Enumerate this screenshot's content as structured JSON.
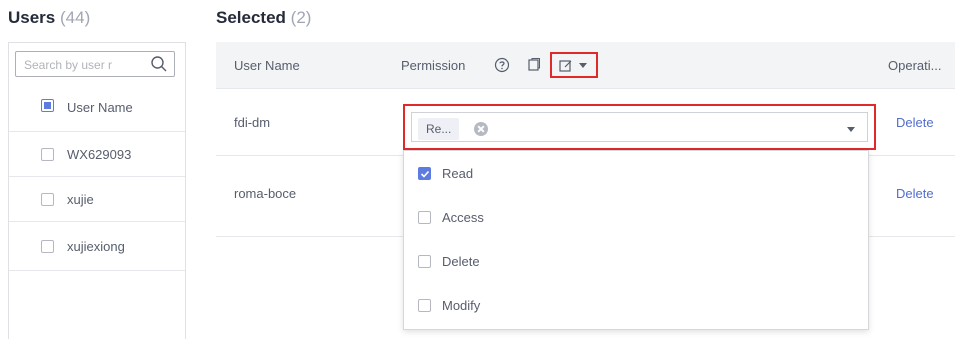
{
  "users_panel": {
    "title": "Users",
    "count": "(44)",
    "search_placeholder": "Search by user r",
    "header_label": "User Name",
    "items": [
      {
        "label": "WX629093"
      },
      {
        "label": "xujie"
      },
      {
        "label": "xujiexiong"
      }
    ]
  },
  "selected_panel": {
    "title": "Selected",
    "count": "(2)",
    "columns": {
      "user_name": "User Name",
      "permission": "Permission",
      "operation": "Operati..."
    },
    "rows": [
      {
        "user": "fdi-dm",
        "tag": "Re...",
        "action": "Delete"
      },
      {
        "user": "roma-boce",
        "action": "Delete"
      }
    ],
    "permission_options": [
      {
        "label": "Read",
        "checked": true
      },
      {
        "label": "Access",
        "checked": false
      },
      {
        "label": "Delete",
        "checked": false
      },
      {
        "label": "Modify",
        "checked": false
      }
    ]
  },
  "colors": {
    "accent": "#5e7ce0",
    "link": "#526ecc",
    "highlight": "#e02a2a",
    "header_bg": "#f3f4f6"
  },
  "icons": [
    "search-icon",
    "help-icon",
    "copy-icon",
    "batch-edit-icon",
    "chevron-down-icon",
    "tag-close-icon"
  ]
}
